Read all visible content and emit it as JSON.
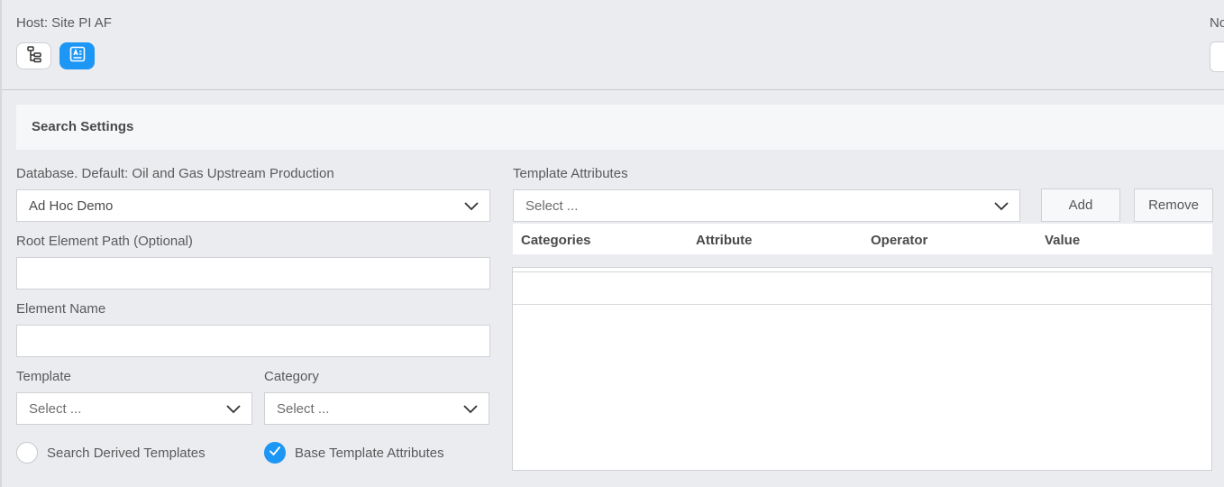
{
  "header": {
    "host_label": "Host: Site PI AF",
    "cut_label": "No"
  },
  "view_buttons": [
    {
      "icon": "hierarchy-tree-icon",
      "active": false
    },
    {
      "icon": "search-card-icon",
      "active": true
    }
  ],
  "section": {
    "title": "Search Settings"
  },
  "form": {
    "database": {
      "label": "Database. Default: Oil and Gas Upstream Production",
      "value": "Ad Hoc Demo"
    },
    "root_path": {
      "label": "Root Element Path (Optional)",
      "value": ""
    },
    "element_name": {
      "label": "Element Name",
      "value": ""
    },
    "template": {
      "label": "Template",
      "placeholder": "Select ..."
    },
    "category": {
      "label": "Category",
      "placeholder": "Select ..."
    },
    "search_derived": {
      "label": "Search Derived Templates",
      "checked": false
    },
    "base_template_attrs": {
      "label": "Base Template Attributes",
      "checked": true
    }
  },
  "template_attributes": {
    "label": "Template Attributes",
    "select_placeholder": "Select ...",
    "add_label": "Add",
    "remove_label": "Remove",
    "columns": [
      "Categories",
      "Attribute",
      "Operator",
      "Value"
    ]
  },
  "colors": {
    "accent": "#1d97f5",
    "background": "#ebecf0"
  }
}
